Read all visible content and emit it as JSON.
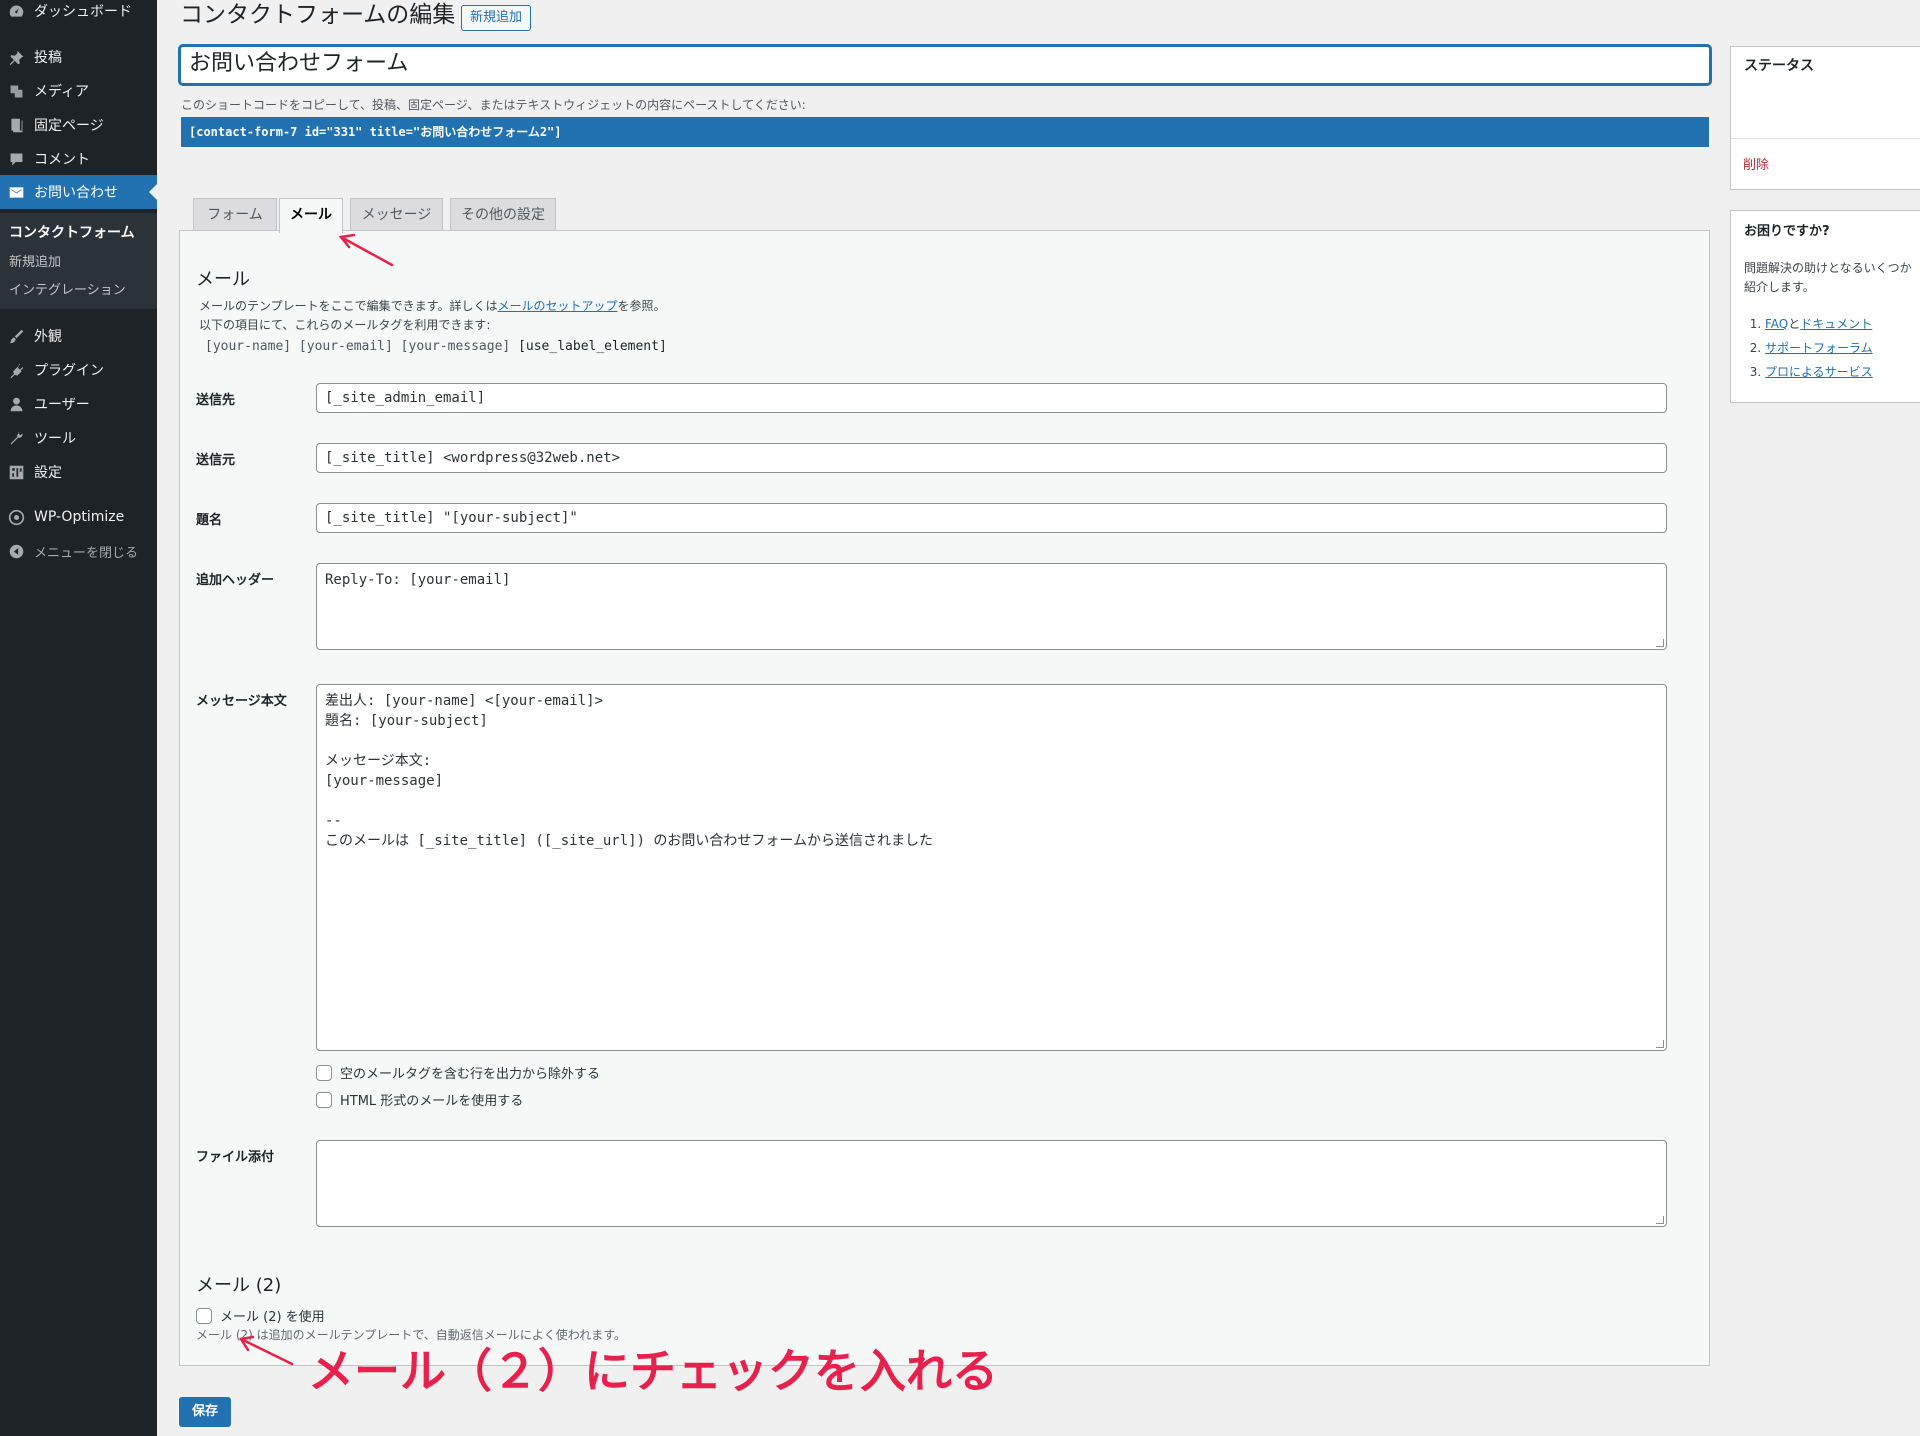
{
  "sidebar": {
    "items": [
      {
        "label": "ダッシュボード",
        "icon": "dashboard-icon"
      },
      {
        "label": "投稿",
        "icon": "pin-icon"
      },
      {
        "label": "メディア",
        "icon": "media-icon"
      },
      {
        "label": "固定ページ",
        "icon": "page-icon"
      },
      {
        "label": "コメント",
        "icon": "comment-icon"
      },
      {
        "label": "お問い合わせ",
        "icon": "mail-icon"
      },
      {
        "label": "外観",
        "icon": "brush-icon"
      },
      {
        "label": "プラグイン",
        "icon": "plugin-icon"
      },
      {
        "label": "ユーザー",
        "icon": "user-icon"
      },
      {
        "label": "ツール",
        "icon": "wrench-icon"
      },
      {
        "label": "設定",
        "icon": "settings-icon"
      },
      {
        "label": "WP-Optimize",
        "icon": "optimize-icon"
      },
      {
        "label": "メニューを閉じる",
        "icon": "collapse-icon"
      }
    ],
    "submenu": [
      "コンタクトフォーム",
      "新規追加",
      "インテグレーション"
    ]
  },
  "header": {
    "title": "コンタクトフォームの編集",
    "add_new": "新規追加"
  },
  "form_title": "お問い合わせフォーム",
  "shortcode": {
    "hint": "このショートコードをコピーして、投稿、固定ページ、またはテキストウィジェットの内容にペーストしてください:",
    "code": "[contact-form-7 id=\"331\" title=\"お問い合わせフォーム2\"]"
  },
  "tabs": [
    "フォーム",
    "メール",
    "メッセージ",
    "その他の設定"
  ],
  "mail": {
    "heading": "メール",
    "desc_pre": "メールのテンプレートをここで編集できます。詳しくは",
    "desc_link": "メールのセットアップ",
    "desc_post": "を参照。",
    "desc_line2": "以下の項目にて、これらのメールタグを利用できます:",
    "tags": "[your-name] [your-email] [your-message]",
    "tag_extra": "[use_label_element]",
    "fields": {
      "to": {
        "label": "送信先",
        "value": "[_site_admin_email]"
      },
      "from": {
        "label": "送信元",
        "value": "[_site_title] <wordpress@32web.net>"
      },
      "subject": {
        "label": "題名",
        "value": "[_site_title] \"[your-subject]\""
      },
      "headers": {
        "label": "追加ヘッダー",
        "value": "Reply-To: [your-email]"
      },
      "body": {
        "label": "メッセージ本文",
        "value": "差出人: [your-name] <[your-email]>\n題名: [your-subject]\n\nメッセージ本文:\n[your-message]\n\n--\nこのメールは [_site_title] ([_site_url]) のお問い合わせフォームから送信されました"
      },
      "attachments": {
        "label": "ファイル添付",
        "value": ""
      }
    },
    "exclude_blank": "空のメールタグを含む行を出力から除外する",
    "use_html": "HTML 形式のメールを使用する"
  },
  "mail2": {
    "heading": "メール (2)",
    "checkbox": "メール (2) を使用",
    "desc": "メール (2) は追加のメールテンプレートで、自動返信メールによく使われます。"
  },
  "save_button": "保存",
  "right": {
    "status": {
      "title": "ステータス",
      "delete": "削除"
    },
    "help": {
      "title": "お困りですか?",
      "desc1": "問題解決の助けとなるいくつか",
      "desc2": "紹介します。",
      "item1_a": "FAQ",
      "item1_b": "と",
      "item1_c": "ドキュメント",
      "item2": "サポートフォーラム",
      "item3": "プロによるサービス"
    }
  },
  "annotation": "メール（２）にチェックを入れる",
  "colors": {
    "accent": "#2271b1",
    "sidebar": "#1d2327",
    "annotation": "#e8204c",
    "delete": "#b32d2e"
  }
}
